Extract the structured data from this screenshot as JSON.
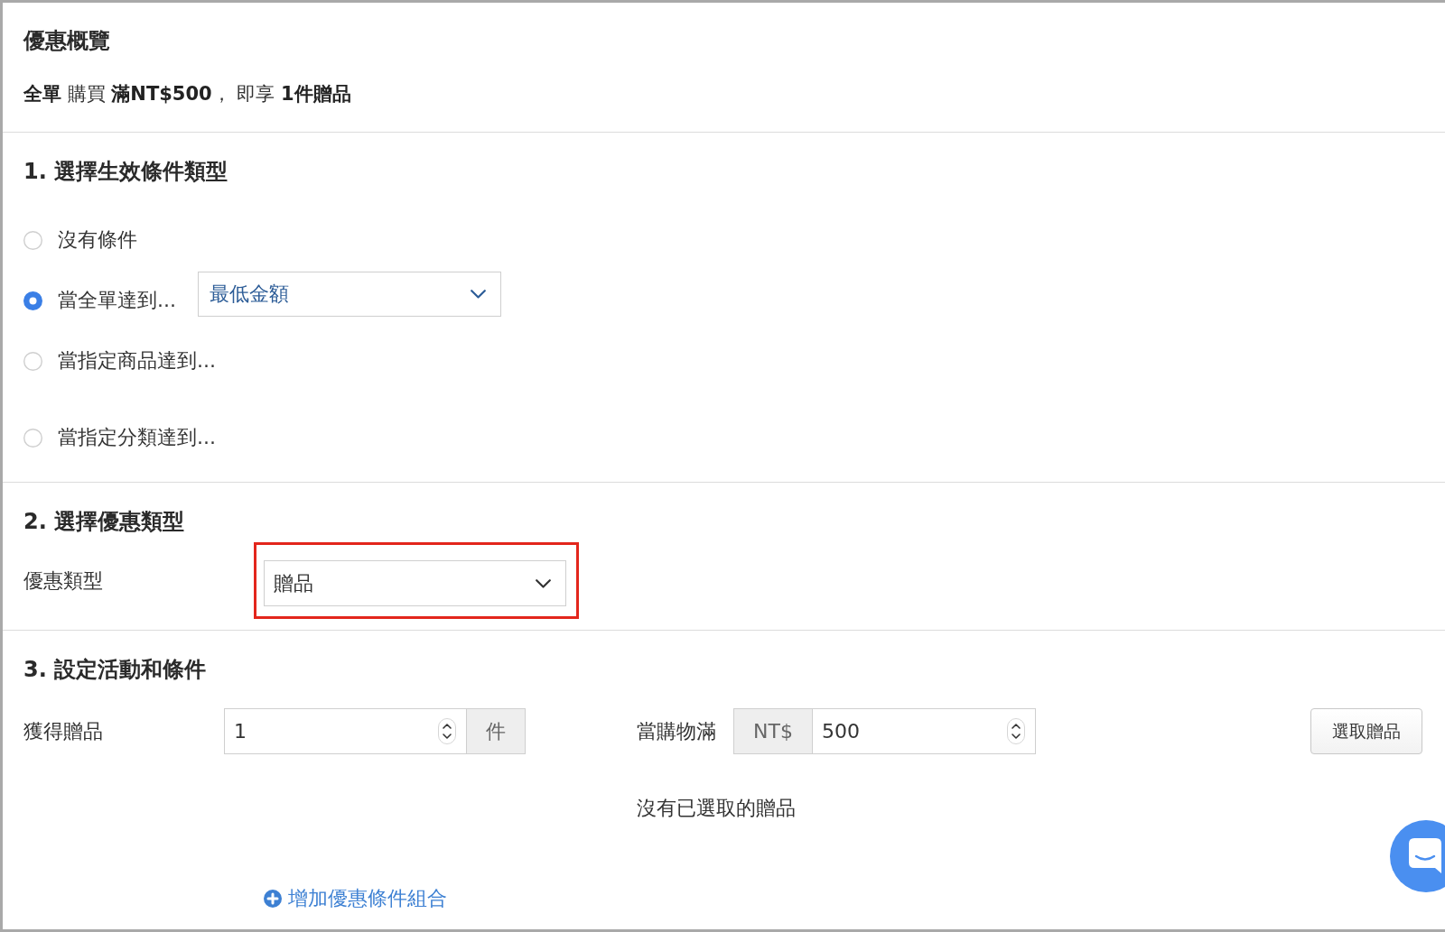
{
  "overview": {
    "title": "優惠概覽",
    "summary": "**全單** 購買 **滿NT$500**， 即享 **1件贈品**"
  },
  "condition_section": {
    "title": "1. 選擇生效條件類型",
    "options": [
      {
        "label": "沒有條件",
        "selected": false
      },
      {
        "label": "當全單達到...",
        "selected": true,
        "dropdown": {
          "value": "最低金額"
        }
      },
      {
        "label": "當指定商品達到...",
        "selected": false
      },
      {
        "label": "當指定分類達到...",
        "selected": false
      }
    ]
  },
  "discount_section": {
    "title": "2. 選擇優惠類型",
    "field_label": "優惠類型",
    "select": {
      "value": "贈品",
      "highlighted": true
    }
  },
  "activity_section": {
    "title": "3. 設定活動和條件",
    "gift_quantity": {
      "label": "獲得贈品",
      "value": "1",
      "unit": "件"
    },
    "spend_threshold": {
      "label": "當購物滿",
      "prefix": "NT$",
      "value": "500"
    },
    "pick_button": "選取贈品",
    "empty_message": "沒有已選取的贈品",
    "add_link": "增加優惠條件組合"
  }
}
